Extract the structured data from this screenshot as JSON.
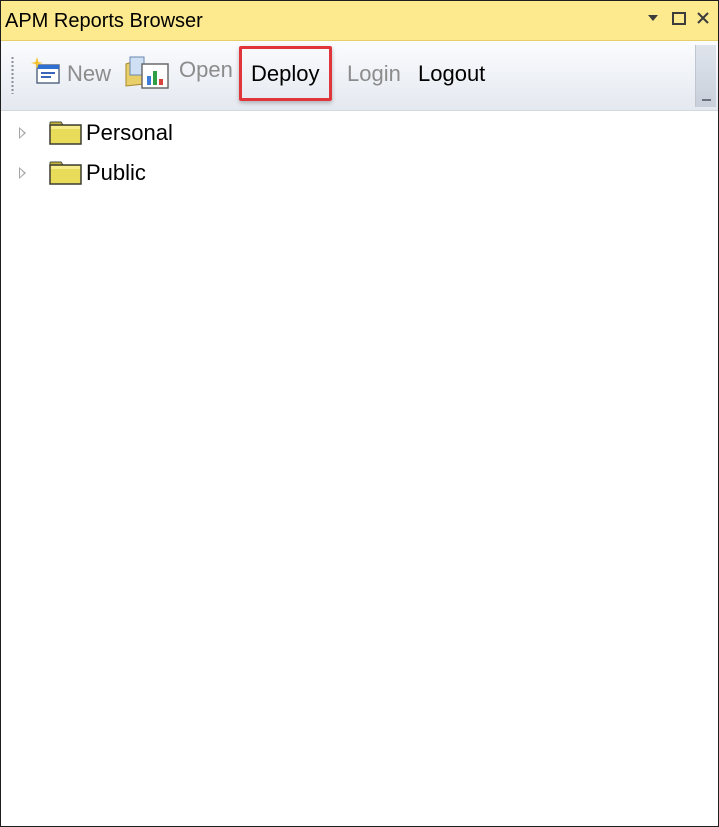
{
  "window": {
    "title": "APM Reports Browser",
    "controls": {
      "dropdown_icon": "chevron-down-icon",
      "maximize_icon": "maximize-icon",
      "close_icon": "close-icon"
    }
  },
  "toolbar": {
    "new_label": "New",
    "open_label": "Open",
    "deploy_label": "Deploy",
    "login_label": "Login",
    "logout_label": "Logout",
    "highlight_color": "#e0353a"
  },
  "tree": {
    "items": [
      {
        "label": "Personal",
        "icon": "folder-icon"
      },
      {
        "label": "Public",
        "icon": "folder-icon"
      }
    ]
  },
  "colors": {
    "titlebar": "#fde98e",
    "folder": "#e9dc5a"
  }
}
